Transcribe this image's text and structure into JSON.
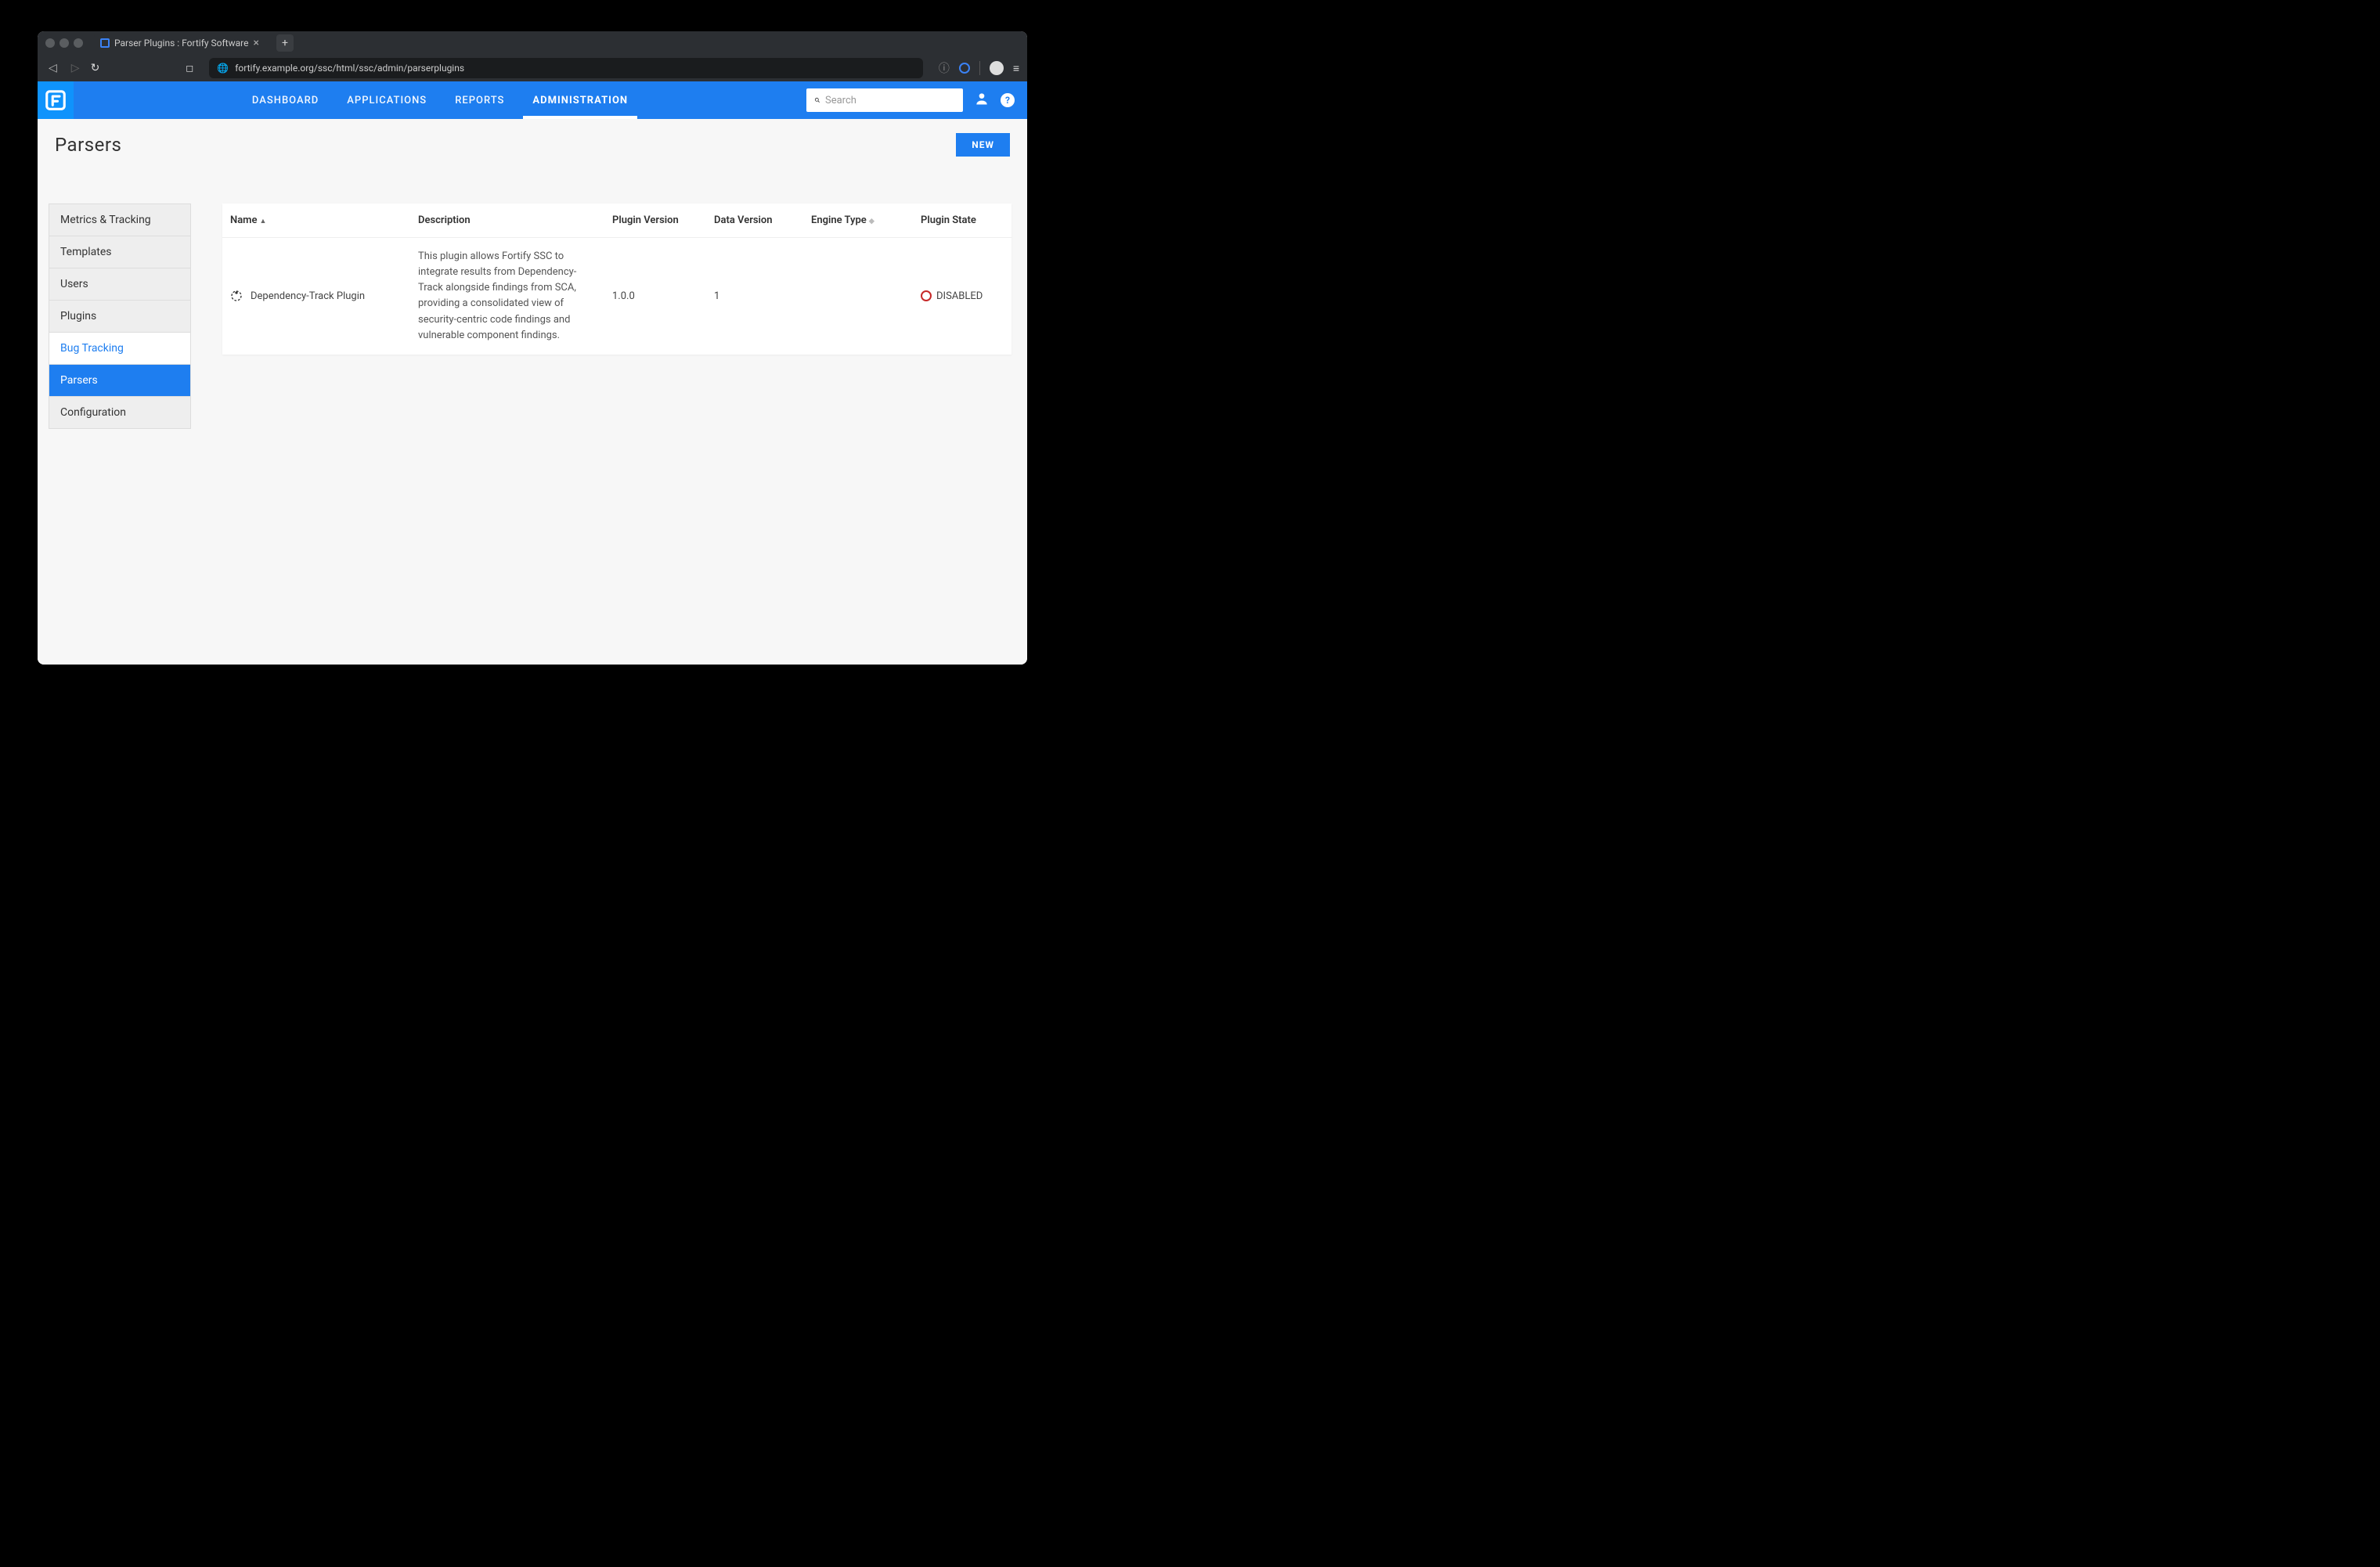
{
  "browser": {
    "tab_title": "Parser Plugins : Fortify Software",
    "url": "fortify.example.org/ssc/html/ssc/admin/parserplugins"
  },
  "topnav": {
    "items": [
      "DASHBOARD",
      "APPLICATIONS",
      "REPORTS",
      "ADMINISTRATION"
    ],
    "search_placeholder": "Search"
  },
  "page": {
    "title": "Parsers",
    "new_button": "NEW"
  },
  "sidebar": {
    "items": [
      {
        "label": "Metrics & Tracking",
        "state": "normal"
      },
      {
        "label": "Templates",
        "state": "normal"
      },
      {
        "label": "Users",
        "state": "normal"
      },
      {
        "label": "Plugins",
        "state": "normal"
      },
      {
        "label": "Bug Tracking",
        "state": "sub"
      },
      {
        "label": "Parsers",
        "state": "active"
      },
      {
        "label": "Configuration",
        "state": "normal"
      }
    ]
  },
  "table": {
    "headers": {
      "name": "Name",
      "desc": "Description",
      "ver": "Plugin Version",
      "data": "Data Version",
      "eng": "Engine Type",
      "state": "Plugin State"
    },
    "rows": [
      {
        "name": "Dependency-Track Plugin",
        "desc": "This plugin allows Fortify SSC to integrate results from Dependency-Track alongside findings from SCA, providing a consolidated view of security-centric code findings and vulnerable component findings.",
        "ver": "1.0.0",
        "data": "1",
        "eng": "",
        "state": "DISABLED"
      }
    ]
  }
}
